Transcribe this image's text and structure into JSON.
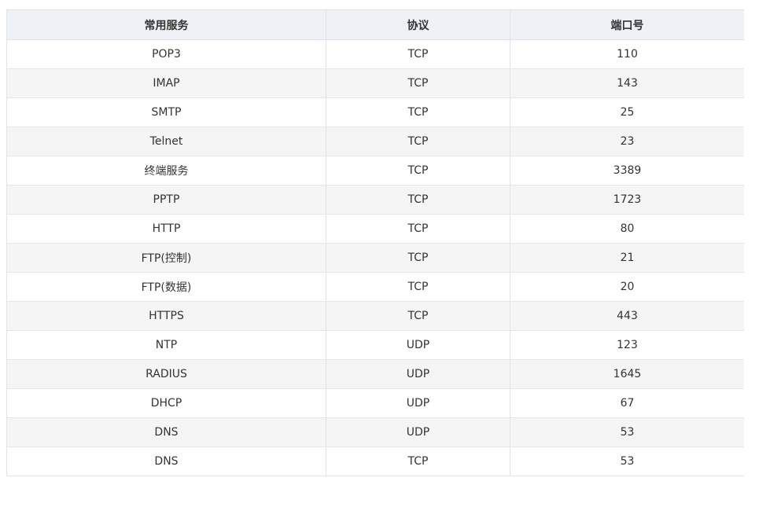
{
  "table": {
    "headers": [
      "常用服务",
      "协议",
      "端口号"
    ],
    "rows": [
      [
        "POP3",
        "TCP",
        "110"
      ],
      [
        "IMAP",
        "TCP",
        "143"
      ],
      [
        "SMTP",
        "TCP",
        "25"
      ],
      [
        "Telnet",
        "TCP",
        "23"
      ],
      [
        "终端服务",
        "TCP",
        "3389"
      ],
      [
        "PPTP",
        "TCP",
        "1723"
      ],
      [
        "HTTP",
        "TCP",
        "80"
      ],
      [
        "FTP(控制)",
        "TCP",
        "21"
      ],
      [
        "FTP(数据)",
        "TCP",
        "20"
      ],
      [
        "HTTPS",
        "TCP",
        "443"
      ],
      [
        "NTP",
        "UDP",
        "123"
      ],
      [
        "RADIUS",
        "UDP",
        "1645"
      ],
      [
        "DHCP",
        "UDP",
        "67"
      ],
      [
        "DNS",
        "UDP",
        "53"
      ],
      [
        "DNS",
        "TCP",
        "53"
      ]
    ]
  },
  "colors": {
    "header_bg": "#eef1f5",
    "row_alt_bg": "#f5f5f5",
    "border": "#dfe3e8",
    "text": "#333333"
  }
}
